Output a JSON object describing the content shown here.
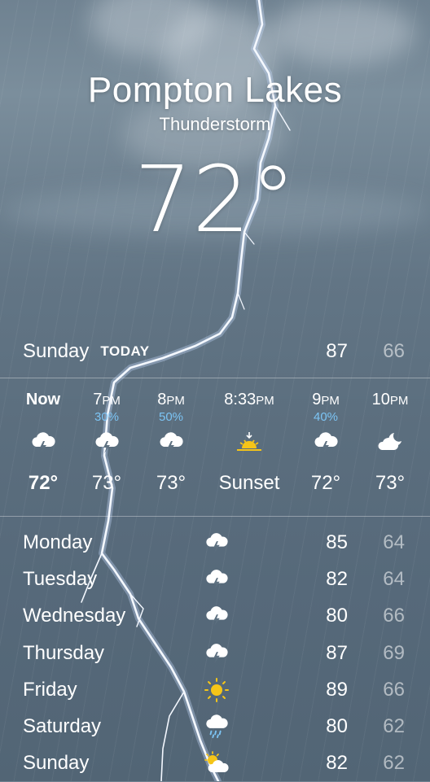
{
  "header": {
    "city": "Pompton Lakes",
    "condition": "Thunderstorm",
    "temperature": "72°"
  },
  "today": {
    "day": "Sunday",
    "tag": "TODAY",
    "high": "87",
    "low": "66"
  },
  "hourly": [
    {
      "time": "Now",
      "ampm": "",
      "precip": "",
      "icon": "thunderstorm-icon",
      "temp": "72°"
    },
    {
      "time": "7",
      "ampm": "PM",
      "precip": "30%",
      "icon": "thunderstorm-icon",
      "temp": "73°"
    },
    {
      "time": "8",
      "ampm": "PM",
      "precip": "50%",
      "icon": "thunderstorm-icon",
      "temp": "73°"
    },
    {
      "time": "8:33",
      "ampm": "PM",
      "precip": "",
      "icon": "sunset-icon",
      "temp": "Sunset"
    },
    {
      "time": "9",
      "ampm": "PM",
      "precip": "40%",
      "icon": "thunderstorm-icon",
      "temp": "72°"
    },
    {
      "time": "10",
      "ampm": "PM",
      "precip": "",
      "icon": "partly-cloudy-night-icon",
      "temp": "73°"
    }
  ],
  "daily": [
    {
      "day": "Monday",
      "icon": "thunderstorm-icon",
      "high": "85",
      "low": "64"
    },
    {
      "day": "Tuesday",
      "icon": "thunderstorm-icon",
      "high": "82",
      "low": "64"
    },
    {
      "day": "Wednesday",
      "icon": "thunderstorm-icon",
      "high": "80",
      "low": "66"
    },
    {
      "day": "Thursday",
      "icon": "thunderstorm-icon",
      "high": "87",
      "low": "69"
    },
    {
      "day": "Friday",
      "icon": "sun-icon",
      "high": "89",
      "low": "66"
    },
    {
      "day": "Saturday",
      "icon": "rain-icon",
      "high": "80",
      "low": "62"
    },
    {
      "day": "Sunday",
      "icon": "partly-sunny-icon",
      "high": "82",
      "low": "62"
    }
  ],
  "colors": {
    "precip": "#7cc4f4",
    "sun": "#f5c518",
    "low_temp": "#b4bcc4"
  }
}
